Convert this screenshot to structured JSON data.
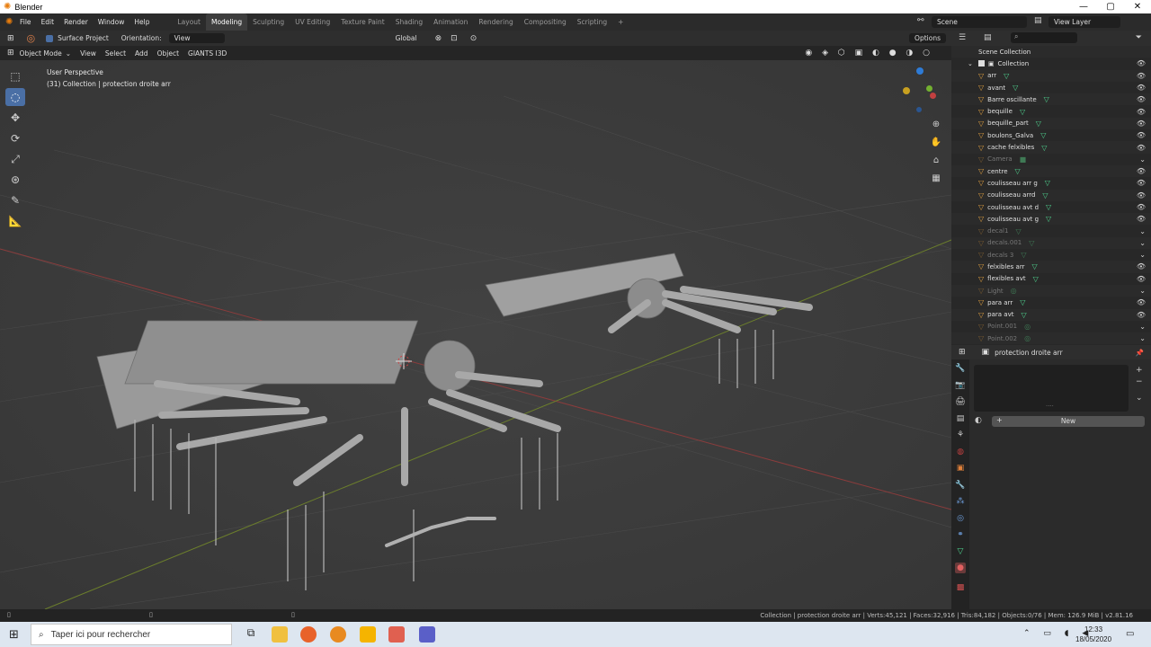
{
  "window": {
    "title": "Blender",
    "min": "—",
    "max": "▢",
    "close": "✕"
  },
  "menu": {
    "items": [
      "File",
      "Edit",
      "Render",
      "Window",
      "Help"
    ]
  },
  "workspaces": {
    "tabs": [
      "Layout",
      "Modeling",
      "Sculpting",
      "UV Editing",
      "Texture Paint",
      "Shading",
      "Animation",
      "Rendering",
      "Compositing",
      "Scripting"
    ],
    "active": "Modeling",
    "add": "+"
  },
  "scene": {
    "name": "Scene",
    "view_layer": "View Layer"
  },
  "tool_settings": {
    "surface_project": "Surface Project",
    "orientation_label": "Orientation:",
    "orientation_value": "View",
    "transform": "Global",
    "options": "Options"
  },
  "header": {
    "mode": "Object Mode",
    "menus": [
      "View",
      "Select",
      "Add",
      "Object",
      "GIANTS I3D"
    ]
  },
  "viewport": {
    "line1": "User Perspective",
    "line2": "(31) Collection | protection droite arr"
  },
  "outliner": {
    "root": "Scene Collection",
    "collection": "Collection",
    "items": [
      {
        "name": "arr",
        "type": "mesh"
      },
      {
        "name": "avant",
        "type": "mesh"
      },
      {
        "name": "Barre oscillante",
        "type": "mesh"
      },
      {
        "name": "bequille",
        "type": "mesh"
      },
      {
        "name": "bequille_part",
        "type": "mesh"
      },
      {
        "name": "boulons_Galva",
        "type": "mesh"
      },
      {
        "name": "cache felxibles",
        "type": "mesh"
      },
      {
        "name": "Camera",
        "type": "camera",
        "dim": true
      },
      {
        "name": "centre",
        "type": "mesh"
      },
      {
        "name": "coulisseau arr g",
        "type": "mesh"
      },
      {
        "name": "coulisseau arrd",
        "type": "mesh"
      },
      {
        "name": "coulisseau avt d",
        "type": "mesh"
      },
      {
        "name": "coulisseau avt g",
        "type": "mesh"
      },
      {
        "name": "decal1",
        "type": "mesh",
        "dim": true
      },
      {
        "name": "decals.001",
        "type": "mesh",
        "dim": true
      },
      {
        "name": "decals 3",
        "type": "mesh",
        "dim": true
      },
      {
        "name": "felxibles arr",
        "type": "mesh"
      },
      {
        "name": "flexibles avt",
        "type": "mesh"
      },
      {
        "name": "Light",
        "type": "light",
        "dim": true
      },
      {
        "name": "para arr",
        "type": "mesh"
      },
      {
        "name": "para avt",
        "type": "mesh"
      },
      {
        "name": "Point.001",
        "type": "light",
        "dim": true
      },
      {
        "name": "Point.002",
        "type": "light",
        "dim": true
      }
    ]
  },
  "properties": {
    "object_name": "protection droite arr",
    "new_label": "New",
    "new_plus": "+",
    "dots": "····"
  },
  "status": {
    "text": "Collection | protection droite arr | Verts:45,121 | Faces:32,916 | Tris:84,182 | Objects:0/76 | Mem: 126.9 MiB | v2.81.16"
  },
  "taskbar": {
    "search_placeholder": "Taper ici pour rechercher",
    "time": "12:33",
    "date": "18/05/2020"
  },
  "colors": {
    "accent": "#4a6fa5",
    "mesh": "#4fd48f",
    "object": "#e0a040"
  }
}
